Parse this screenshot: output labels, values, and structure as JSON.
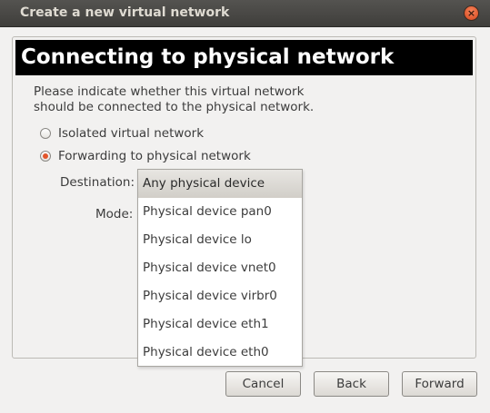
{
  "window": {
    "title": "Create a new virtual network",
    "close_glyph": "×"
  },
  "page": {
    "header": "Connecting to physical network",
    "intro": "Please indicate whether this virtual network\nshould be connected to the physical network."
  },
  "options": {
    "isolated": {
      "label": "Isolated virtual network",
      "checked": false
    },
    "forwarding": {
      "label": "Forwarding to physical network",
      "checked": true
    }
  },
  "fields": {
    "destination_label": "Destination:",
    "mode_label": "Mode:"
  },
  "destination_menu": {
    "selected": "Any physical device",
    "items": [
      "Any physical device",
      "Physical device pan0",
      "Physical device lo",
      "Physical device vnet0",
      "Physical device virbr0",
      "Physical device eth1",
      "Physical device eth0"
    ]
  },
  "buttons": {
    "cancel": "Cancel",
    "back": "Back",
    "forward": "Forward"
  },
  "colors": {
    "accent": "#e2552b",
    "titlebar": "#3f3e3b",
    "banner": "#000000"
  }
}
